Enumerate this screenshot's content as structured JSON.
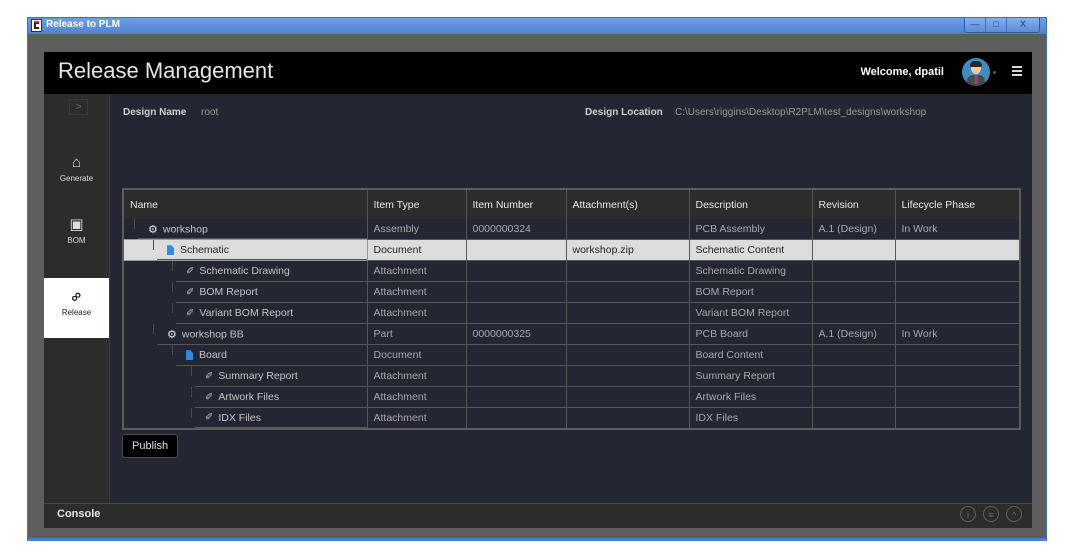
{
  "window": {
    "title": "Release to PLM",
    "controls": {
      "minimize": "—",
      "maximize": "□",
      "close": "X"
    }
  },
  "header": {
    "title": "Release Management",
    "welcome": "Welcome, dpatil",
    "menu_icon": "hamburger-menu-icon"
  },
  "sidebar": {
    "expand_icon": ">",
    "items": [
      {
        "label": "Generate",
        "icon": "home-icon",
        "glyph": "⌂",
        "active": false
      },
      {
        "label": "BOM",
        "icon": "briefcase-icon",
        "glyph": "▣",
        "active": false
      },
      {
        "label": "Release",
        "icon": "link-icon",
        "glyph": "∞",
        "active": true
      }
    ]
  },
  "design": {
    "name_label": "Design Name",
    "name_value": "root",
    "location_label": "Design Location",
    "location_value": "C:\\Users\\riggins\\Desktop\\R2PLM\\test_designs\\workshop"
  },
  "table": {
    "columns": [
      "Name",
      "Item Type",
      "Item Number",
      "Attachment(s)",
      "Description",
      "Revision",
      "Lifecycle Phase"
    ],
    "rows": [
      {
        "level": 0,
        "icon": "gear",
        "name": "workshop",
        "item_type": "Assembly",
        "item_number": "0000000324",
        "attachments": "",
        "description": "PCB Assembly",
        "revision": "A.1 (Design)",
        "lifecycle": "In Work",
        "selected": false
      },
      {
        "level": 1,
        "icon": "doc",
        "name": "Schematic",
        "item_type": "Document",
        "item_number": "",
        "attachments": "workshop.zip",
        "description": "Schematic Content",
        "revision": "",
        "lifecycle": "",
        "selected": true
      },
      {
        "level": 2,
        "icon": "clip",
        "name": "Schematic Drawing",
        "item_type": "Attachment",
        "item_number": "",
        "attachments": "",
        "description": "Schematic Drawing",
        "revision": "",
        "lifecycle": "",
        "selected": false
      },
      {
        "level": 2,
        "icon": "clip",
        "name": "BOM Report",
        "item_type": "Attachment",
        "item_number": "",
        "attachments": "",
        "description": "BOM Report",
        "revision": "",
        "lifecycle": "",
        "selected": false
      },
      {
        "level": 2,
        "icon": "clip",
        "name": "Variant BOM Report",
        "item_type": "Attachment",
        "item_number": "",
        "attachments": "",
        "description": "Variant BOM Report",
        "revision": "",
        "lifecycle": "",
        "selected": false
      },
      {
        "level": 1,
        "icon": "gear",
        "name": "workshop BB",
        "item_type": "Part",
        "item_number": "0000000325",
        "attachments": "",
        "description": "PCB Board",
        "revision": "A.1 (Design)",
        "lifecycle": "In Work",
        "selected": false
      },
      {
        "level": 2,
        "icon": "doc",
        "name": "Board",
        "item_type": "Document",
        "item_number": "",
        "attachments": "",
        "description": "Board Content",
        "revision": "",
        "lifecycle": "",
        "selected": false
      },
      {
        "level": 3,
        "icon": "clip",
        "name": "Summary Report",
        "item_type": "Attachment",
        "item_number": "",
        "attachments": "",
        "description": "Summary Report",
        "revision": "",
        "lifecycle": "",
        "selected": false
      },
      {
        "level": 3,
        "icon": "clip",
        "name": "Artwork Files",
        "item_type": "Attachment",
        "item_number": "",
        "attachments": "",
        "description": "Artwork Files",
        "revision": "",
        "lifecycle": "",
        "selected": false
      },
      {
        "level": 3,
        "icon": "clip",
        "name": "IDX Files",
        "item_type": "Attachment",
        "item_number": "",
        "attachments": "",
        "description": "IDX Files",
        "revision": "",
        "lifecycle": "",
        "selected": false
      }
    ]
  },
  "actions": {
    "publish_label": "Publish"
  },
  "console": {
    "label": "Console",
    "icons": [
      {
        "name": "info-icon",
        "glyph": "i"
      },
      {
        "name": "trash-icon",
        "glyph": "≡"
      },
      {
        "name": "chevron-up-icon",
        "glyph": "^"
      }
    ]
  },
  "colors": {
    "accent_link": "#4e8ed6",
    "document_icon": "#2d8be8",
    "selected_row": "#dcdcdc",
    "main_bg": "#222733"
  }
}
